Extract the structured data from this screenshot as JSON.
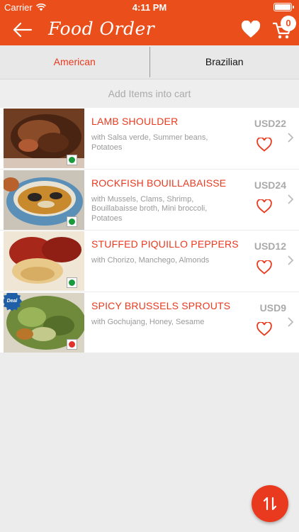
{
  "status": {
    "carrier": "Carrier",
    "time": "4:11 PM"
  },
  "header": {
    "title": "Food Order",
    "cart_count": "0"
  },
  "tabs": [
    {
      "label": "American",
      "active": true
    },
    {
      "label": "Brazilian",
      "active": false
    }
  ],
  "hint": "Add Items into cart",
  "items": [
    {
      "name": "LAMB SHOULDER",
      "desc": "with Salsa verde, Summer beans, Potatoes",
      "price": "USD22",
      "veg": true,
      "deal": false
    },
    {
      "name": "ROCKFISH BOUILLABAISSE",
      "desc": "with Mussels, Clams, Shrimp, Bouillabaisse broth, Mini broccoli, Potatoes",
      "price": "USD24",
      "veg": true,
      "deal": false
    },
    {
      "name": "STUFFED PIQUILLO PEPPERS",
      "desc": "with Chorizo, Manchego, Almonds",
      "price": "USD12",
      "veg": true,
      "deal": false
    },
    {
      "name": "SPICY BRUSSELS SPROUTS",
      "desc": "with Gochujang, Honey, Sesame",
      "price": "USD9",
      "veg": false,
      "deal": true,
      "deal_label": "Deal"
    }
  ],
  "colors": {
    "accent": "#e94e1b",
    "name": "#e93a1f",
    "veg": "#1a9a3c",
    "nonveg": "#e0322b"
  }
}
